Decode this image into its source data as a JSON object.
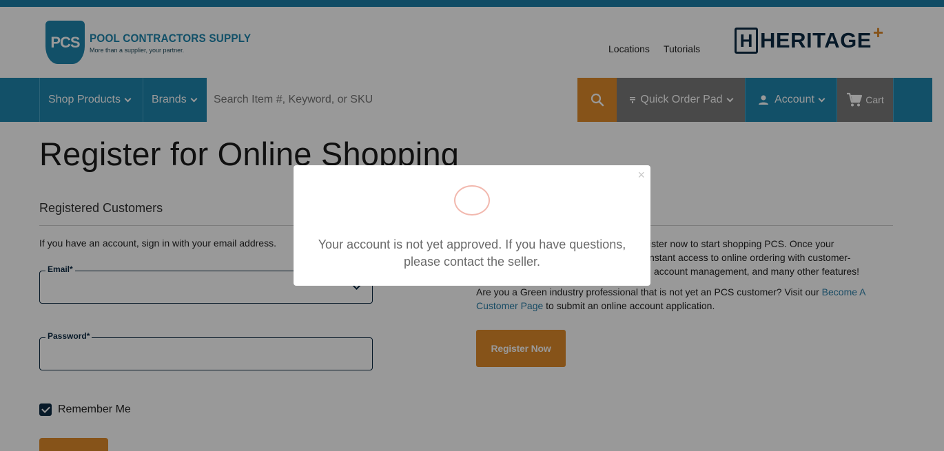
{
  "header": {
    "logo": {
      "badge": "PCS",
      "name": "POOL CONTRACTORS SUPPLY",
      "tagline": "More than a supplier, your partner."
    },
    "links": [
      "Locations",
      "Tutorials"
    ],
    "partner_logo": {
      "mark": "H",
      "word": "HERITAGE",
      "plus": "+"
    }
  },
  "nav": {
    "shop_products": "Shop Products",
    "brands": "Brands",
    "search_placeholder": "Search Item #, Keyword, or SKU",
    "quick_order": "Quick Order Pad",
    "account": "Account",
    "cart": "Cart"
  },
  "main": {
    "title": "Register for Online Shopping",
    "registered": {
      "heading": "Registered Customers",
      "intro": "If you have an account, sign in with your email address.",
      "email_label": "Email*",
      "password_label": "Password*",
      "remember_label": "Remember Me"
    },
    "new_customers": {
      "line1": "ister now to start shopping PCS. Once your",
      "line2": "nstant access to online ordering with customer-",
      "line3": "account management, and many other features!",
      "green_text": "Are you a Green industry professional that is not yet an PCS customer? Visit our ",
      "green_link": "Become A Customer Page",
      "green_tail": " to submit an online account application.",
      "register_button": "Register Now"
    }
  },
  "modal": {
    "close": "×",
    "message": "Your account is not yet approved. If you have questions, please contact the seller."
  },
  "colors": {
    "brand_blue": "#1e85ad",
    "accent_orange": "#e08a2a",
    "navy": "#0c2a44"
  }
}
